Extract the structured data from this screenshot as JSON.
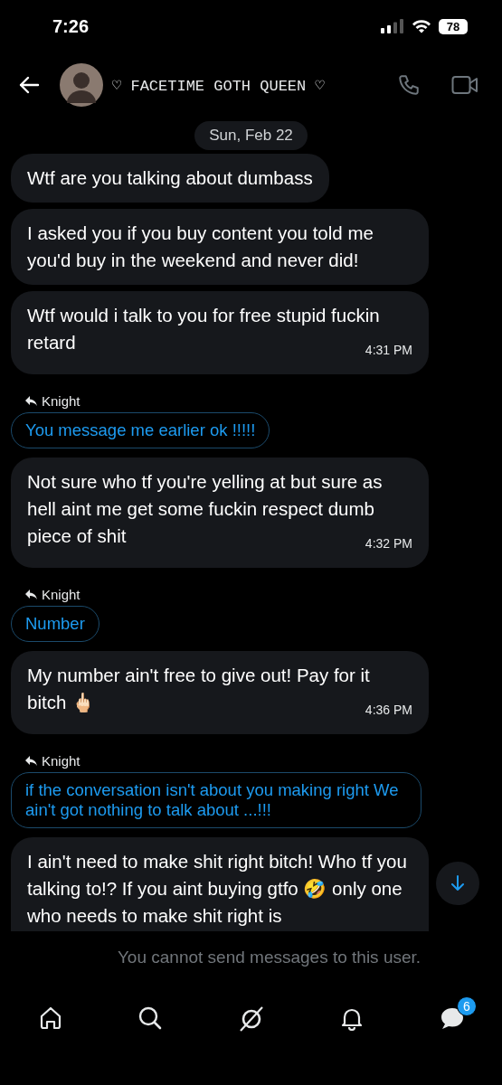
{
  "status_bar": {
    "time": "7:26",
    "battery": "78"
  },
  "header": {
    "title": "♡ FACETIME GOTH QUEEN ♡"
  },
  "date": "Sun, Feb 22",
  "messages": [
    {
      "kind": "incoming",
      "text": "Wtf are you talking about dumbass"
    },
    {
      "kind": "incoming",
      "text": "I asked you if you buy content you told me you'd buy in the weekend and never did!"
    },
    {
      "kind": "incoming",
      "text": "Wtf would i talk to you for free stupid fuckin retard",
      "time": "4:31 PM"
    },
    {
      "kind": "reply",
      "reply_to": "Knight",
      "text": "You message me earlier ok !!!!!"
    },
    {
      "kind": "incoming",
      "text": "Not sure who tf you're yelling at but sure as hell aint me get some fuckin respect dumb piece of shit",
      "time": "4:32 PM"
    },
    {
      "kind": "reply",
      "reply_to": "Knight",
      "text": "Number"
    },
    {
      "kind": "incoming",
      "text": "My number ain't free to give out! Pay for it bitch 🖕🏻",
      "time": "4:36 PM"
    },
    {
      "kind": "reply",
      "reply_to": "Knight",
      "text": "if the conversation isn't about you making right We ain't got nothing to talk about ...!!!"
    },
    {
      "kind": "incoming",
      "text": "I ain't need to make shit right bitch! Who tf you talking to!? If you aint buying gtfo 🤣 only one who needs to make shit right is",
      "cut": true
    }
  ],
  "notice": "You cannot send messages to this user.",
  "messages_badge": "6"
}
